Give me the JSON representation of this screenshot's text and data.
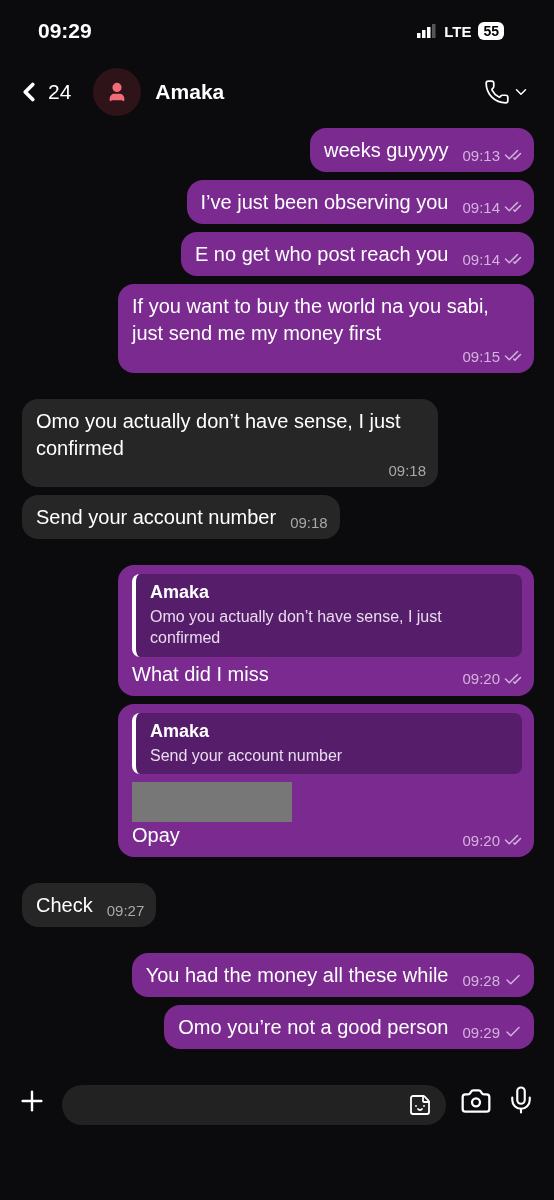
{
  "status_bar": {
    "time": "09:29",
    "network": "LTE",
    "battery": "55"
  },
  "header": {
    "back_count": "24",
    "contact": "Amaka"
  },
  "messages": [
    {
      "kind": "sent",
      "text": "weeks guyyyy",
      "time": "09:13",
      "read": true
    },
    {
      "kind": "sent",
      "text": "I’ve just been observing you",
      "time": "09:14",
      "read": true
    },
    {
      "kind": "sent",
      "text": "E no get who post reach you",
      "time": "09:14",
      "read": true
    },
    {
      "kind": "sent",
      "text": "If you want to buy the world na you sabi, just send me my money first",
      "time": "09:15",
      "read": true
    },
    {
      "kind": "received",
      "text": "Omo you actually don’t have sense, I just confirmed",
      "time": "09:18"
    },
    {
      "kind": "received",
      "text": "Send your account number",
      "time": "09:18"
    },
    {
      "kind": "sent",
      "quote": {
        "author": "Amaka",
        "text": "Omo you actually don’t have sense, I just confirmed"
      },
      "text": "What did I miss",
      "time": "09:20",
      "read": true
    },
    {
      "kind": "sent",
      "quote": {
        "author": "Amaka",
        "text": "Send your account number"
      },
      "redacted": true,
      "text": "Opay",
      "time": "09:20",
      "read": true
    },
    {
      "kind": "received",
      "text": "Check",
      "time": "09:27"
    },
    {
      "kind": "sent",
      "text": "You had the money all these while",
      "time": "09:28",
      "read": false
    },
    {
      "kind": "sent",
      "text": "Omo you’re not a good person",
      "time": "09:29",
      "read": false
    }
  ]
}
